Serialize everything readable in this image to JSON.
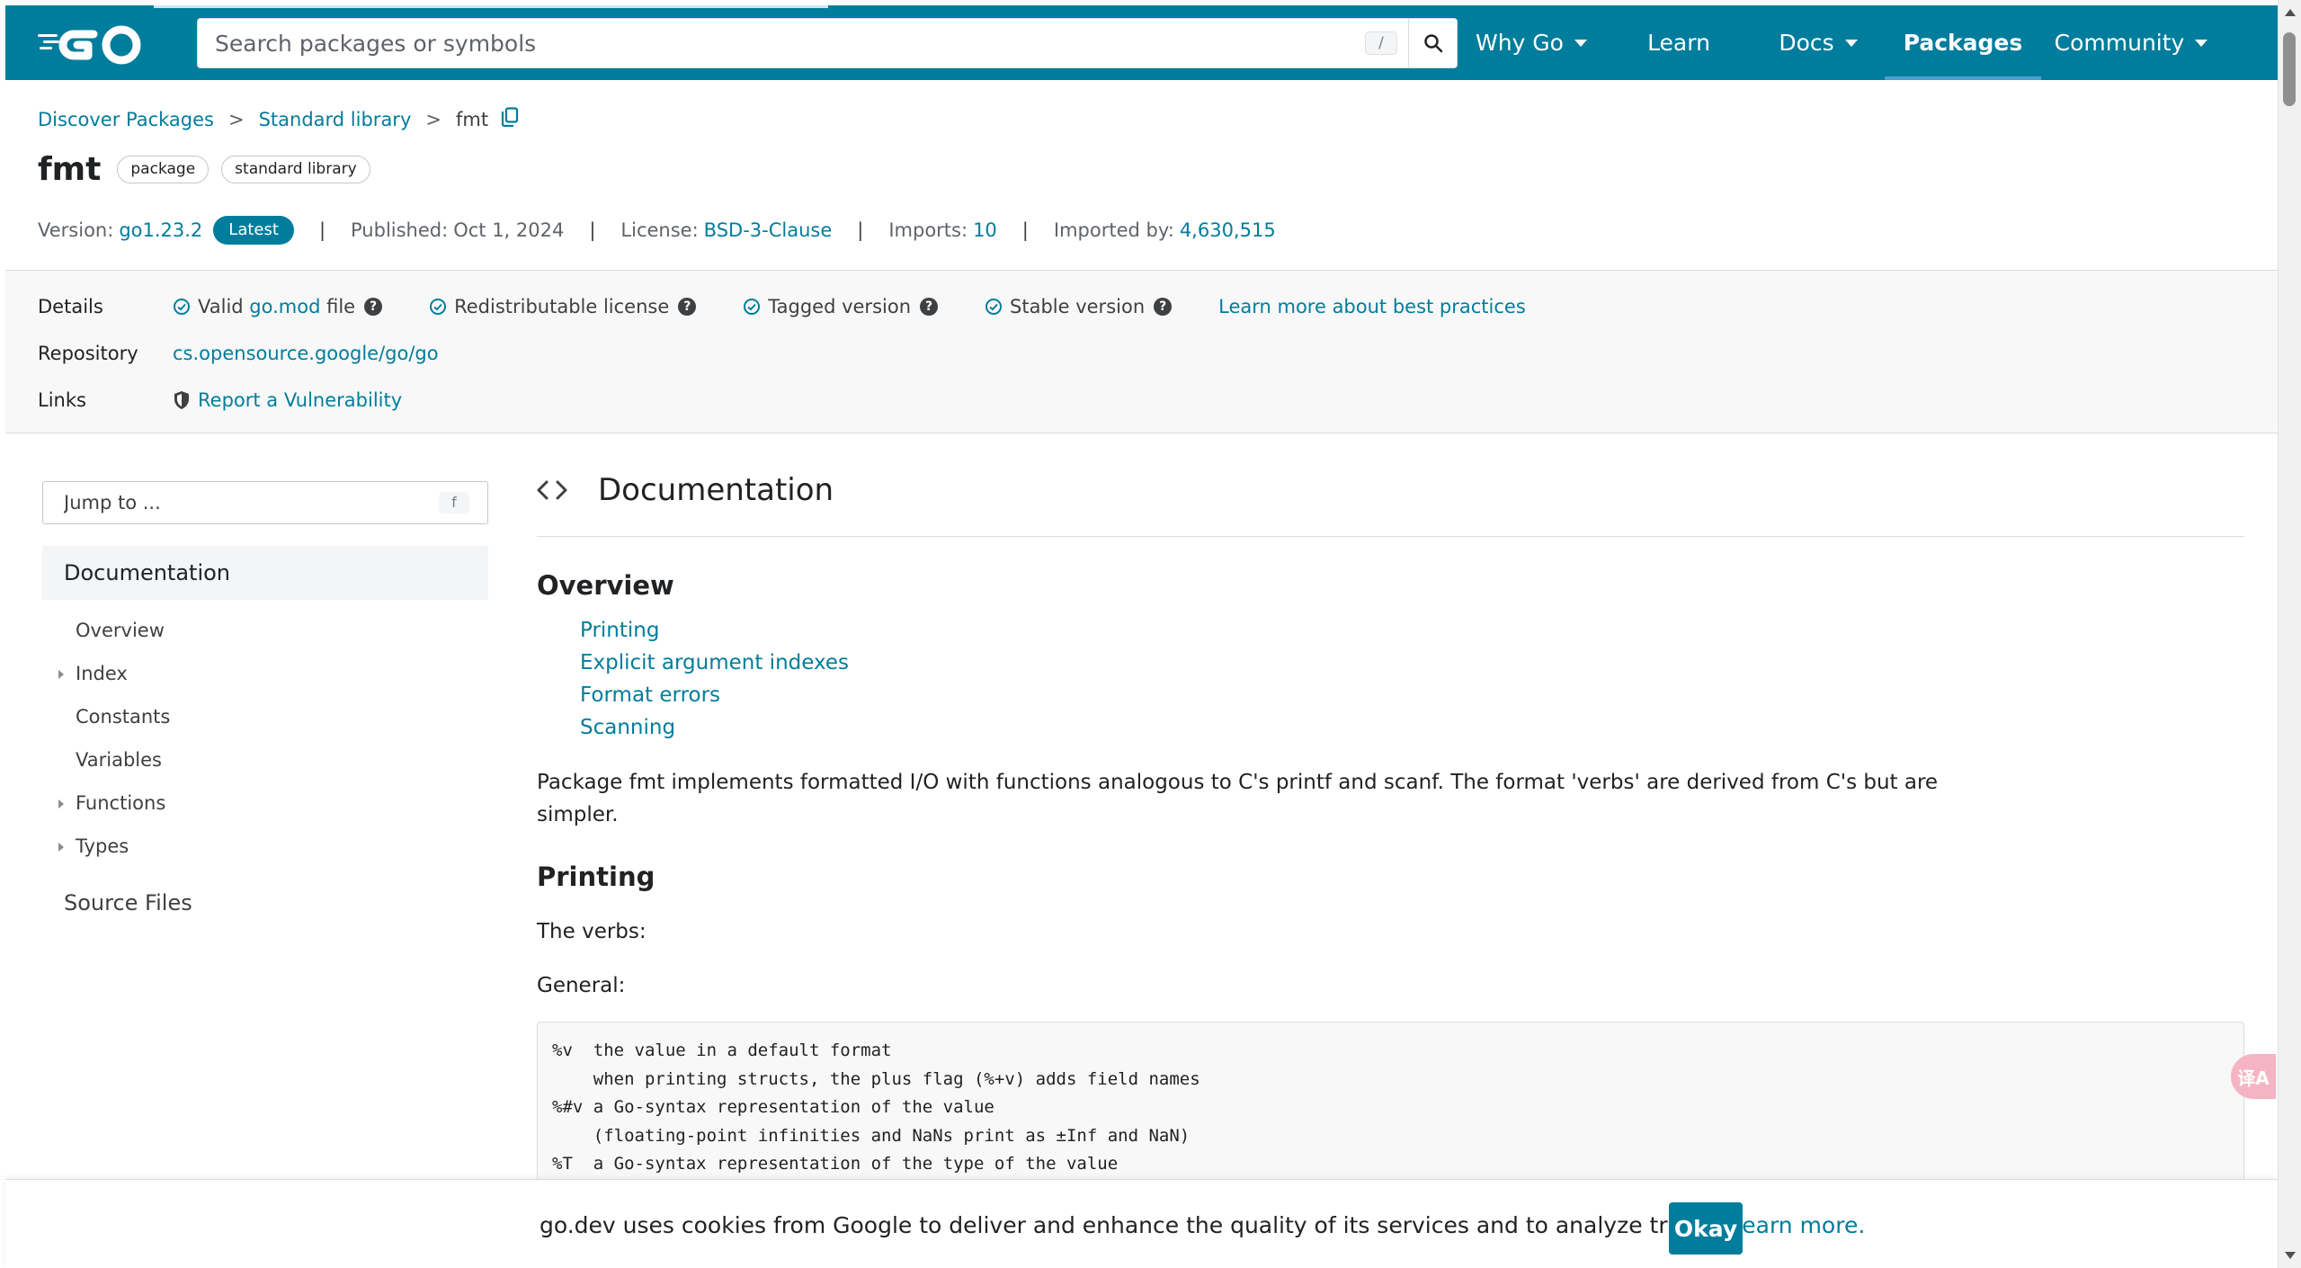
{
  "colors": {
    "brand": "#007d9c",
    "link": "#007d9c",
    "badge": "#007d9c"
  },
  "header": {
    "logo_icon": "go-logo",
    "search_placeholder": "Search packages or symbols",
    "search_shortcut": "/",
    "nav": [
      {
        "label": "Why Go",
        "dropdown": true
      },
      {
        "label": "Learn",
        "dropdown": false
      },
      {
        "label": "Docs",
        "dropdown": true
      },
      {
        "label": "Packages",
        "dropdown": false,
        "active": true
      },
      {
        "label": "Community",
        "dropdown": true
      }
    ]
  },
  "breadcrumb": {
    "items": [
      "Discover Packages",
      "Standard library"
    ],
    "current": "fmt",
    "separator": ">"
  },
  "package": {
    "name": "fmt",
    "chips": [
      "package",
      "standard library"
    ],
    "version_label": "Version:",
    "version": "go1.23.2",
    "version_badge": "Latest",
    "published_label": "Published:",
    "published": "Oct 1, 2024",
    "license_label": "License:",
    "license": "BSD-3-Clause",
    "imports_label": "Imports:",
    "imports": "10",
    "imported_by_label": "Imported by:",
    "imported_by": "4,630,515"
  },
  "details": {
    "details_label": "Details",
    "checks": {
      "gomod_prefix": "Valid",
      "gomod_link": "go.mod",
      "gomod_suffix": "file",
      "license": "Redistributable license",
      "tagged": "Tagged version",
      "stable": "Stable version"
    },
    "best_practices": "Learn more about best practices",
    "repository_label": "Repository",
    "repository": "cs.opensource.google/go/go",
    "links_label": "Links",
    "vulnerability": "Report a Vulnerability"
  },
  "sidebar": {
    "jump_placeholder": "Jump to ...",
    "jump_shortcut": "f",
    "documentation": "Documentation",
    "items": [
      {
        "label": "Overview",
        "expandable": false
      },
      {
        "label": "Index",
        "expandable": true
      },
      {
        "label": "Constants",
        "expandable": false
      },
      {
        "label": "Variables",
        "expandable": false
      },
      {
        "label": "Functions",
        "expandable": true
      },
      {
        "label": "Types",
        "expandable": true
      }
    ],
    "source_files": "Source Files"
  },
  "main": {
    "doc_title": "Documentation",
    "overview_title": "Overview",
    "toc": [
      "Printing",
      "Explicit argument indexes",
      "Format errors",
      "Scanning"
    ],
    "intro_line1": "Package fmt implements formatted I/O with functions analogous to C's printf and scanf. The format 'verbs' are derived from C's but are",
    "intro_line2": "simpler.",
    "printing_title": "Printing",
    "verbs_text": "The verbs:",
    "general_text": "General:",
    "code_lines": [
      "%v  the value in a default format",
      "    when printing structs, the plus flag (%+v) adds field names",
      "%#v a Go-syntax representation of the value",
      "    (floating-point infinities and NaNs print as ±Inf and NaN)",
      "%T  a Go-syntax representation of the type of the value"
    ]
  },
  "fab": {
    "label": "译A",
    "icon": "translate-icon"
  },
  "cookie": {
    "message": "go.dev uses cookies from Google to deliver and enhance the quality of its services and to analyze traffic.",
    "learn_more": "Learn more.",
    "ok": "Okay"
  }
}
